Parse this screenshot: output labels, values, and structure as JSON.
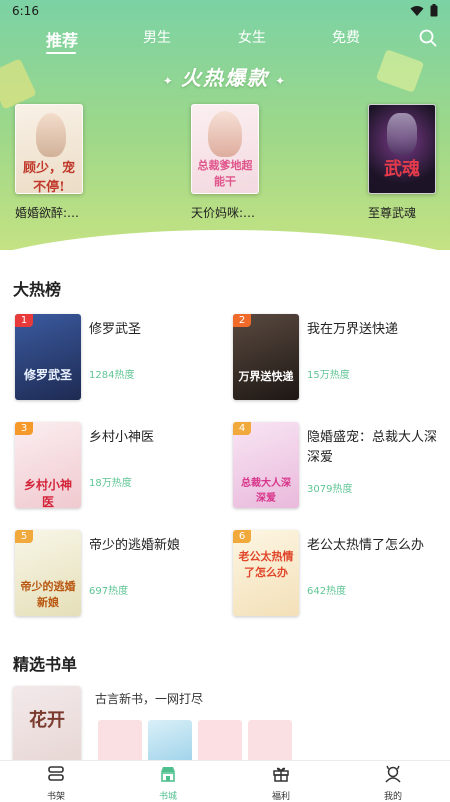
{
  "status_bar": {
    "time": "6:16"
  },
  "tabs": [
    {
      "label": "推荐",
      "active": true
    },
    {
      "label": "男生"
    },
    {
      "label": "女生"
    },
    {
      "label": "免费"
    }
  ],
  "banner": {
    "title": "火热爆款",
    "books": [
      {
        "name": "婚婚欲醉:…",
        "cover_text": "顾少，宠不停!",
        "cover_color": "#f4ece2"
      },
      {
        "name": "天价妈咪:…",
        "cover_text": "总裁爹地超能干",
        "cover_color": "#f6e4e6"
      },
      {
        "name": "至尊武魂",
        "cover_text": "武魂",
        "cover_color": "#2a2335"
      }
    ]
  },
  "hot_list": {
    "title": "大热榜",
    "items": [
      {
        "rank": "1",
        "title": "修罗武圣",
        "heat": "1284热度",
        "badge_color": "#e83a3a",
        "cover_color": "#2b3c74",
        "cover_text": "修罗武圣"
      },
      {
        "rank": "2",
        "title": "我在万界送快递",
        "heat": "15万热度",
        "badge_color": "#f06a2a",
        "cover_color": "#3a2e2a",
        "cover_text": "万界送快递"
      },
      {
        "rank": "3",
        "title": "乡村小神医",
        "heat": "18万热度",
        "badge_color": "#f59a2a",
        "cover_color": "#f4dde0",
        "cover_text": "乡村小神医"
      },
      {
        "rank": "4",
        "title": "隐婚盛宠：总裁大人深深爱",
        "heat": "3079热度",
        "badge_color": "#f0a93a",
        "cover_color": "#f3d9ec",
        "cover_text": "总裁大人深深爱"
      },
      {
        "rank": "5",
        "title": "帝少的逃婚新娘",
        "heat": "697热度",
        "badge_color": "#f0a93a",
        "cover_color": "#f4f0dc",
        "cover_text": "帝少的逃婚新娘"
      },
      {
        "rank": "6",
        "title": "老公太热情了怎么办",
        "heat": "642热度",
        "badge_color": "#f0a93a",
        "cover_color": "#fbf2dc",
        "cover_text": "老公太热情了怎么办"
      }
    ]
  },
  "booklist": {
    "title": "精选书单",
    "description": "古言新书，一网打尽",
    "cover_text": "花开",
    "mini_covers": [
      "#fbe0e3",
      "#cfe9f3",
      "#fbdfe2",
      "#fbe0e3"
    ]
  },
  "bottom_nav": [
    {
      "label": "书架",
      "icon": "bookshelf-icon"
    },
    {
      "label": "书城",
      "icon": "bookstore-icon",
      "active": true
    },
    {
      "label": "福利",
      "icon": "gift-icon"
    },
    {
      "label": "我的",
      "icon": "profile-icon"
    }
  ]
}
